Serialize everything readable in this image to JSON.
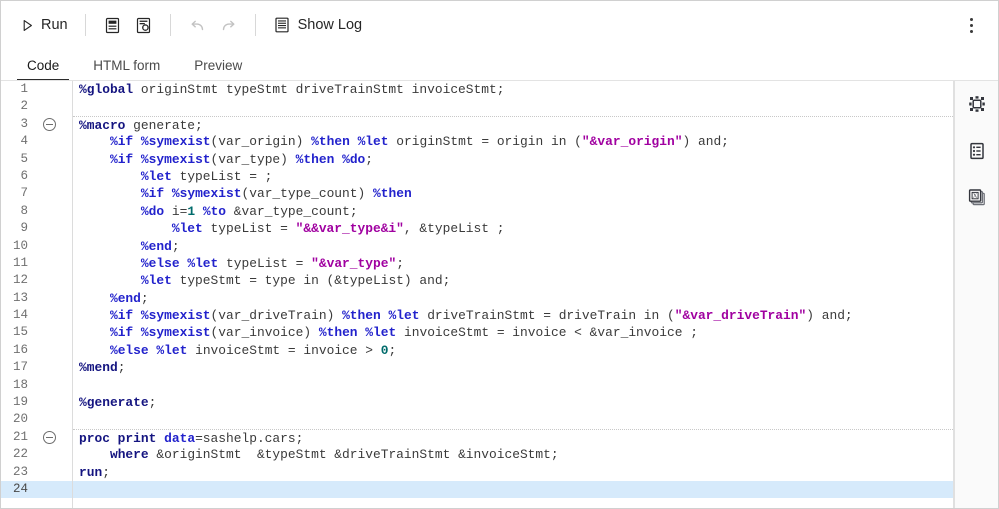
{
  "toolbar": {
    "run_label": "Run",
    "run_icon": "play-triangle-icon",
    "form_icon": "html-form-icon",
    "form_settings_icon": "form-settings-icon",
    "undo_icon": "undo-arrow-icon",
    "redo_icon": "redo-arrow-icon",
    "show_log_label": "Show Log",
    "show_log_icon": "log-lines-icon",
    "overflow_icon": "kebab-menu-icon"
  },
  "tabs": [
    {
      "label": "Code",
      "active": true
    },
    {
      "label": "HTML form",
      "active": false
    },
    {
      "label": "Preview",
      "active": false
    }
  ],
  "right_rail": [
    {
      "icon": "snippets-transform-icon",
      "title": "Snippets"
    },
    {
      "icon": "properties-list-icon",
      "title": "Properties"
    },
    {
      "icon": "libraries-stack-icon",
      "title": "Libraries"
    }
  ],
  "editor": {
    "active_line": 24,
    "total_lines": 24,
    "fold_lines": [
      3,
      21
    ],
    "separator_lines": [
      3,
      21
    ],
    "colors": {
      "keyword": "#2222cc",
      "macro": "#141480",
      "string": "#a000a0",
      "number": "#006b6b",
      "plain": "#3a3a3a",
      "active_line_bg": "#d6eafb",
      "gutter_text": "#707070"
    },
    "lines": [
      {
        "n": 1,
        "tokens": [
          {
            "t": "%global",
            "c": "mac"
          },
          {
            "t": " originStmt typeStmt driveTrainStmt invoiceStmt;",
            "c": "pln"
          }
        ]
      },
      {
        "n": 2,
        "tokens": []
      },
      {
        "n": 3,
        "tokens": [
          {
            "t": "%macro",
            "c": "mac"
          },
          {
            "t": " generate;",
            "c": "pln"
          }
        ]
      },
      {
        "n": 4,
        "tokens": [
          {
            "t": "    ",
            "c": "pln"
          },
          {
            "t": "%if",
            "c": "kw"
          },
          {
            "t": " ",
            "c": "pln"
          },
          {
            "t": "%symexist",
            "c": "kw"
          },
          {
            "t": "(var_origin) ",
            "c": "pln"
          },
          {
            "t": "%then",
            "c": "kw"
          },
          {
            "t": " ",
            "c": "pln"
          },
          {
            "t": "%let",
            "c": "kw"
          },
          {
            "t": " originStmt = origin in (",
            "c": "pln"
          },
          {
            "t": "\"&var_origin\"",
            "c": "str"
          },
          {
            "t": ") and;",
            "c": "pln"
          }
        ]
      },
      {
        "n": 5,
        "tokens": [
          {
            "t": "    ",
            "c": "pln"
          },
          {
            "t": "%if",
            "c": "kw"
          },
          {
            "t": " ",
            "c": "pln"
          },
          {
            "t": "%symexist",
            "c": "kw"
          },
          {
            "t": "(var_type) ",
            "c": "pln"
          },
          {
            "t": "%then",
            "c": "kw"
          },
          {
            "t": " ",
            "c": "pln"
          },
          {
            "t": "%do",
            "c": "kw"
          },
          {
            "t": ";",
            "c": "pln"
          }
        ]
      },
      {
        "n": 6,
        "tokens": [
          {
            "t": "        ",
            "c": "pln"
          },
          {
            "t": "%let",
            "c": "kw"
          },
          {
            "t": " typeList = ;",
            "c": "pln"
          }
        ]
      },
      {
        "n": 7,
        "tokens": [
          {
            "t": "        ",
            "c": "pln"
          },
          {
            "t": "%if",
            "c": "kw"
          },
          {
            "t": " ",
            "c": "pln"
          },
          {
            "t": "%symexist",
            "c": "kw"
          },
          {
            "t": "(var_type_count) ",
            "c": "pln"
          },
          {
            "t": "%then",
            "c": "kw"
          }
        ]
      },
      {
        "n": 8,
        "tokens": [
          {
            "t": "        ",
            "c": "pln"
          },
          {
            "t": "%do",
            "c": "kw"
          },
          {
            "t": " i=",
            "c": "pln"
          },
          {
            "t": "1",
            "c": "num"
          },
          {
            "t": " ",
            "c": "pln"
          },
          {
            "t": "%to",
            "c": "kw"
          },
          {
            "t": " &var_type_count;",
            "c": "pln"
          }
        ]
      },
      {
        "n": 9,
        "tokens": [
          {
            "t": "            ",
            "c": "pln"
          },
          {
            "t": "%let",
            "c": "kw"
          },
          {
            "t": " typeList = ",
            "c": "pln"
          },
          {
            "t": "\"&&var_type&i\"",
            "c": "str"
          },
          {
            "t": ", &typeList ;",
            "c": "pln"
          }
        ]
      },
      {
        "n": 10,
        "tokens": [
          {
            "t": "        ",
            "c": "pln"
          },
          {
            "t": "%end",
            "c": "kw"
          },
          {
            "t": ";",
            "c": "pln"
          }
        ]
      },
      {
        "n": 11,
        "tokens": [
          {
            "t": "        ",
            "c": "pln"
          },
          {
            "t": "%else",
            "c": "kw"
          },
          {
            "t": " ",
            "c": "pln"
          },
          {
            "t": "%let",
            "c": "kw"
          },
          {
            "t": " typeList = ",
            "c": "pln"
          },
          {
            "t": "\"&var_type\"",
            "c": "str"
          },
          {
            "t": ";",
            "c": "pln"
          }
        ]
      },
      {
        "n": 12,
        "tokens": [
          {
            "t": "        ",
            "c": "pln"
          },
          {
            "t": "%let",
            "c": "kw"
          },
          {
            "t": " typeStmt = type in (&typeList) and;",
            "c": "pln"
          }
        ]
      },
      {
        "n": 13,
        "tokens": [
          {
            "t": "    ",
            "c": "pln"
          },
          {
            "t": "%end",
            "c": "kw"
          },
          {
            "t": ";",
            "c": "pln"
          }
        ]
      },
      {
        "n": 14,
        "tokens": [
          {
            "t": "    ",
            "c": "pln"
          },
          {
            "t": "%if",
            "c": "kw"
          },
          {
            "t": " ",
            "c": "pln"
          },
          {
            "t": "%symexist",
            "c": "kw"
          },
          {
            "t": "(var_driveTrain) ",
            "c": "pln"
          },
          {
            "t": "%then",
            "c": "kw"
          },
          {
            "t": " ",
            "c": "pln"
          },
          {
            "t": "%let",
            "c": "kw"
          },
          {
            "t": " driveTrainStmt = driveTrain in (",
            "c": "pln"
          },
          {
            "t": "\"&var_driveTrain\"",
            "c": "str"
          },
          {
            "t": ") and;",
            "c": "pln"
          }
        ]
      },
      {
        "n": 15,
        "tokens": [
          {
            "t": "    ",
            "c": "pln"
          },
          {
            "t": "%if",
            "c": "kw"
          },
          {
            "t": " ",
            "c": "pln"
          },
          {
            "t": "%symexist",
            "c": "kw"
          },
          {
            "t": "(var_invoice) ",
            "c": "pln"
          },
          {
            "t": "%then",
            "c": "kw"
          },
          {
            "t": " ",
            "c": "pln"
          },
          {
            "t": "%let",
            "c": "kw"
          },
          {
            "t": " invoiceStmt = invoice < &var_invoice ;",
            "c": "pln"
          }
        ]
      },
      {
        "n": 16,
        "tokens": [
          {
            "t": "    ",
            "c": "pln"
          },
          {
            "t": "%else",
            "c": "kw"
          },
          {
            "t": " ",
            "c": "pln"
          },
          {
            "t": "%let",
            "c": "kw"
          },
          {
            "t": " invoiceStmt = invoice > ",
            "c": "pln"
          },
          {
            "t": "0",
            "c": "num"
          },
          {
            "t": ";",
            "c": "pln"
          }
        ]
      },
      {
        "n": 17,
        "tokens": [
          {
            "t": "%mend",
            "c": "mac"
          },
          {
            "t": ";",
            "c": "pln"
          }
        ]
      },
      {
        "n": 18,
        "tokens": []
      },
      {
        "n": 19,
        "tokens": [
          {
            "t": "%generate",
            "c": "mac"
          },
          {
            "t": ";",
            "c": "pln"
          }
        ]
      },
      {
        "n": 20,
        "tokens": []
      },
      {
        "n": 21,
        "tokens": [
          {
            "t": "proc print",
            "c": "proc"
          },
          {
            "t": " ",
            "c": "pln"
          },
          {
            "t": "data",
            "c": "opt"
          },
          {
            "t": "=sashelp.cars;",
            "c": "pln"
          }
        ]
      },
      {
        "n": 22,
        "tokens": [
          {
            "t": "    ",
            "c": "pln"
          },
          {
            "t": "where",
            "c": "proc"
          },
          {
            "t": " &originStmt  &typeStmt &driveTrainStmt &invoiceStmt;",
            "c": "pln"
          }
        ]
      },
      {
        "n": 23,
        "tokens": [
          {
            "t": "run",
            "c": "proc"
          },
          {
            "t": ";",
            "c": "pln"
          }
        ]
      },
      {
        "n": 24,
        "tokens": []
      }
    ]
  }
}
